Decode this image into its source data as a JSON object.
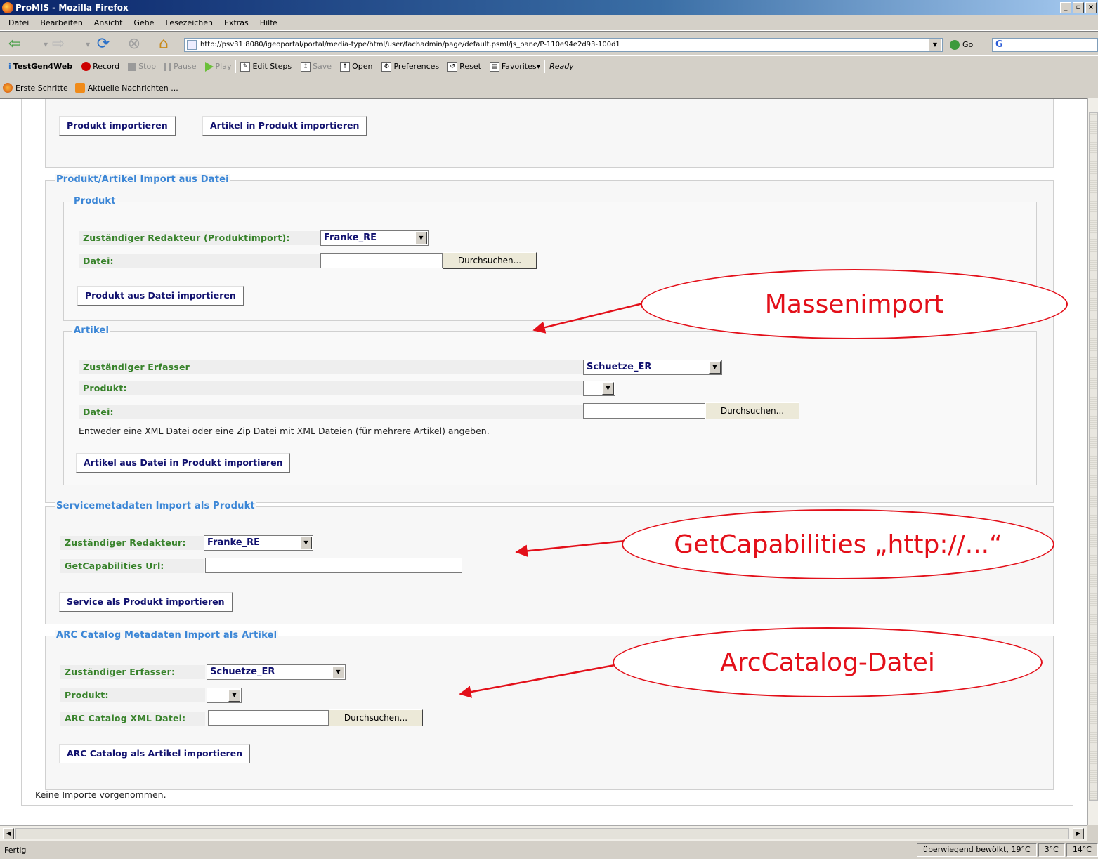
{
  "window": {
    "title": "ProMIS - Mozilla Firefox",
    "controls": [
      "_",
      "▫",
      "×"
    ]
  },
  "menu": [
    "Datei",
    "Bearbeiten",
    "Ansicht",
    "Gehe",
    "Lesezeichen",
    "Extras",
    "Hilfe"
  ],
  "nav": {
    "url": "http://psv31:8080/igeoportal/portal/media-type/html/user/fachadmin/page/default.psml/js_pane/P-110e94e2d93-100d1",
    "go_label": "Go",
    "search_logo": "G"
  },
  "testbar": {
    "name": "TestGen4Web",
    "record": "Record",
    "stop": "Stop",
    "pause": "Pause",
    "play": "Play",
    "edit_steps": "Edit Steps",
    "save": "Save",
    "open": "Open",
    "preferences": "Preferences",
    "reset": "Reset",
    "favorites": "Favorites▾",
    "status": "Ready"
  },
  "bookmarks": [
    "Erste Schritte",
    "Aktuelle Nachrichten ..."
  ],
  "page": {
    "top_buttons": {
      "produkt": "Produkt importieren",
      "artikel": "Artikel in Produkt importieren"
    },
    "file_import": {
      "legend": "Produkt/Artikel Import aus Datei",
      "produkt": {
        "legend": "Produkt",
        "redakteur_label": "Zuständiger Redakteur (Produktimport):",
        "redakteur_value": "Franke_RE",
        "datei_label": "Datei:",
        "browse": "Durchsuchen...",
        "button": "Produkt aus Datei importieren"
      },
      "artikel": {
        "legend": "Artikel",
        "erfasser_label": "Zuständiger Erfasser",
        "erfasser_value": "Schuetze_ER",
        "produkt_label": "Produkt:",
        "produkt_value": "",
        "datei_label": "Datei:",
        "browse": "Durchsuchen...",
        "hint": "Entweder eine XML Datei oder eine Zip Datei mit XML Dateien (für mehrere Artikel) angeben.",
        "button": "Artikel aus Datei in Produkt importieren"
      }
    },
    "service": {
      "legend": "Servicemetadaten Import als Produkt",
      "redakteur_label": "Zuständiger Redakteur:",
      "redakteur_value": "Franke_RE",
      "url_label": "GetCapabilities Url:",
      "url_value": "",
      "button": "Service als Produkt importieren"
    },
    "arc": {
      "legend": "ARC Catalog Metadaten Import als Artikel",
      "erfasser_label": "Zuständiger Erfasser:",
      "erfasser_value": "Schuetze_ER",
      "produkt_label": "Produkt:",
      "produkt_value": "",
      "datei_label": "ARC Catalog XML Datei:",
      "browse": "Durchsuchen...",
      "button": "ARC Catalog als Artikel importieren"
    },
    "footer_note": "Keine Importe vorgenommen."
  },
  "annotations": {
    "mass": "Massenimport",
    "getcap": "GetCapabilities „http://...“",
    "arc": "ArcCatalog-Datei",
    "color": "#e3101a"
  },
  "status": {
    "left": "Fertig",
    "weather": "überwiegend bewölkt, 19°C",
    "temp2": "3°C",
    "temp3": "14°C"
  }
}
